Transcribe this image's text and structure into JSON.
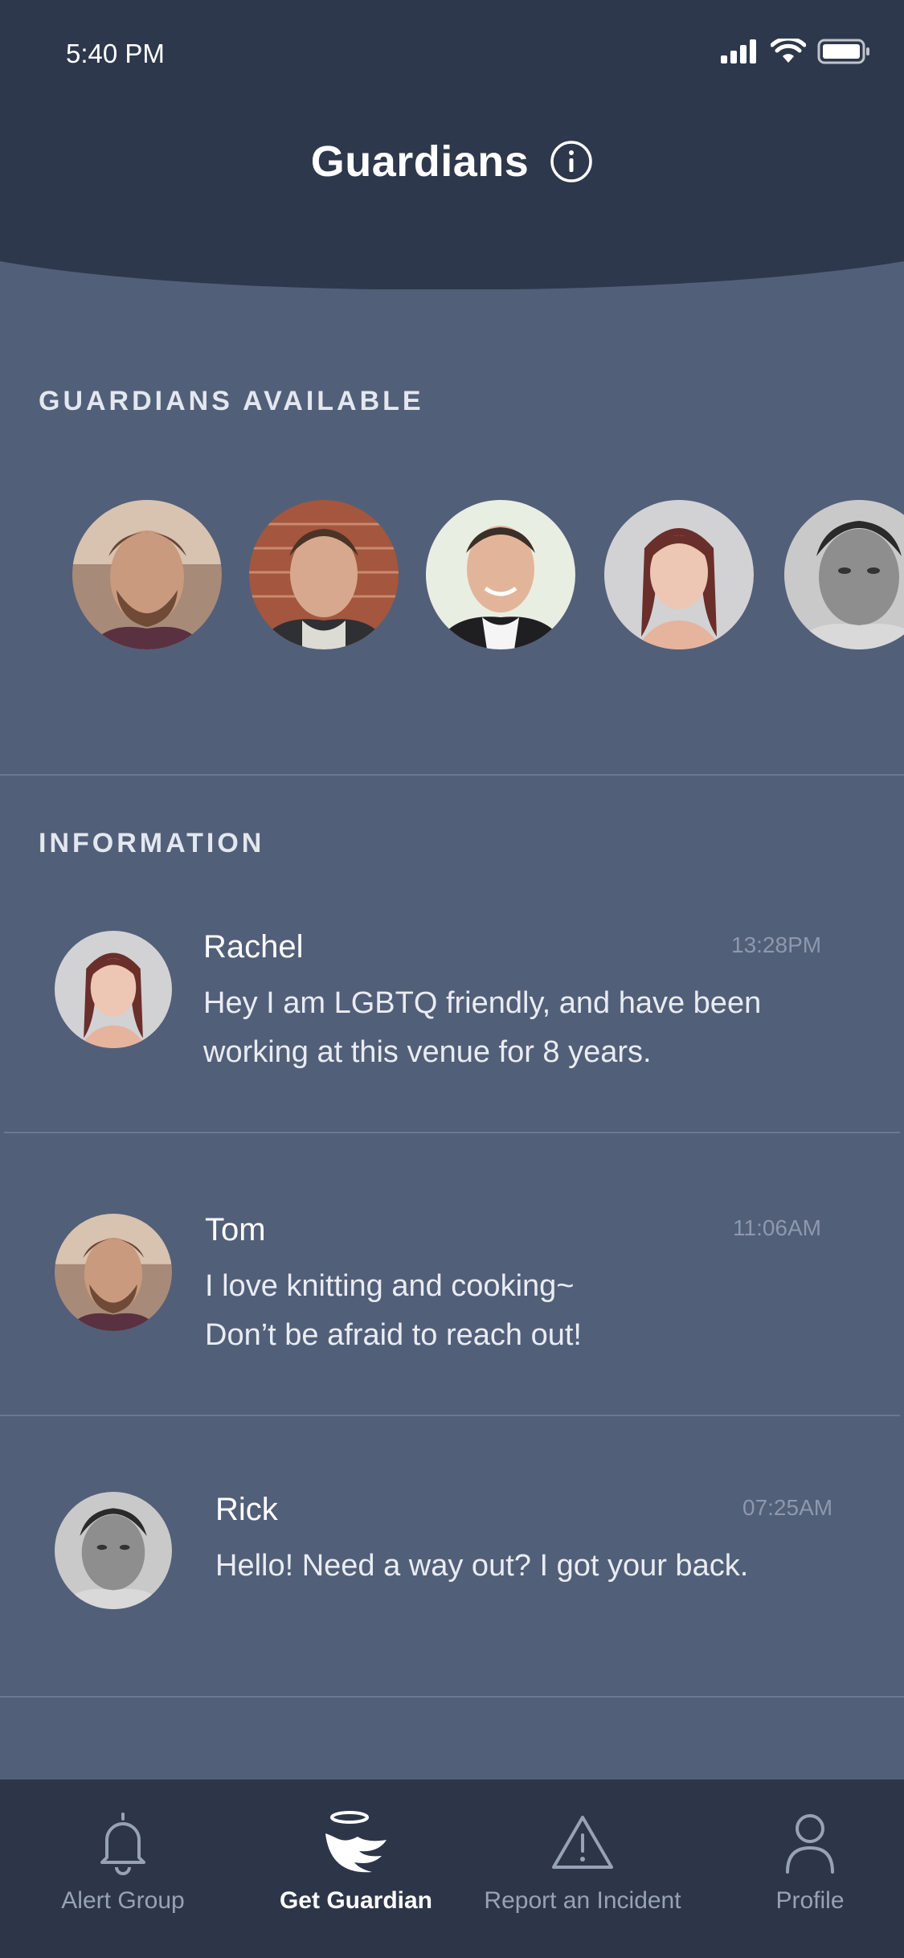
{
  "status_bar": {
    "time": "5:40 PM"
  },
  "header": {
    "title": "Guardians",
    "info_icon": "info-icon"
  },
  "sections": {
    "available_label": "GUARDIANS AVAILABLE",
    "information_label": "INFORMATION"
  },
  "guardians_available": [
    {
      "name": "guardian-avatar-1"
    },
    {
      "name": "guardian-avatar-2"
    },
    {
      "name": "guardian-avatar-3"
    },
    {
      "name": "guardian-avatar-4"
    },
    {
      "name": "guardian-avatar-5"
    }
  ],
  "messages": [
    {
      "name": "Rachel",
      "time": "13:28PM",
      "line1": "Hey I am LGBTQ friendly, and have been",
      "line2": "working at this venue for 8 years."
    },
    {
      "name": "Tom",
      "time": "11:06AM",
      "line1": "I love knitting and cooking~",
      "line2": "Don’t be afraid to reach out!"
    },
    {
      "name": "Rick",
      "time": "07:25AM",
      "line1": "Hello! Need a way out? I got your back.",
      "line2": ""
    }
  ],
  "tabs": [
    {
      "label": "Alert Group",
      "icon": "bell-icon",
      "active": false
    },
    {
      "label": "Get Guardian",
      "icon": "angel-wing-icon",
      "active": true
    },
    {
      "label": "Report an Incident",
      "icon": "warning-icon",
      "active": false
    },
    {
      "label": "Profile",
      "icon": "person-icon",
      "active": false
    }
  ],
  "colors": {
    "header_bg": "#2e384c",
    "body_bg": "#525f79",
    "tabbar_bg": "#2d3649",
    "divider": "#6c7893"
  }
}
